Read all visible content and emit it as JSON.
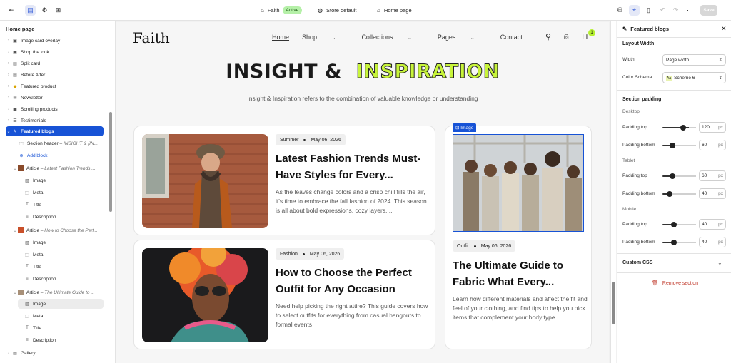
{
  "topbar": {
    "store_name": "Faith",
    "status_badge": "Active",
    "store_default": "Store default",
    "page_name": "Home page",
    "save_label": "Save"
  },
  "left_panel": {
    "title": "Home page",
    "items": [
      {
        "label": "Image card overlay",
        "icon": "image-icon"
      },
      {
        "label": "Shop the look",
        "icon": "image-icon"
      },
      {
        "label": "Split card",
        "icon": "grid-icon"
      },
      {
        "label": "Before After",
        "icon": "grid-icon"
      },
      {
        "label": "Featured product",
        "icon": "tag-icon"
      },
      {
        "label": "Newsletter",
        "icon": "mail-icon"
      },
      {
        "label": "Scrolling products",
        "icon": "image-icon"
      },
      {
        "label": "Testimonials",
        "icon": "list-icon"
      },
      {
        "label": "Featured blogs",
        "icon": "edit-icon"
      },
      {
        "label": "Section header",
        "suffix": "– INSIGHT & [IN..."
      },
      {
        "label": "Add block"
      },
      {
        "label": "Article",
        "suffix": "– Latest Fashion Trends ..."
      },
      {
        "label": "Image"
      },
      {
        "label": "Meta"
      },
      {
        "label": "Title"
      },
      {
        "label": "Description"
      },
      {
        "label": "Article",
        "suffix": "– How to Choose the Perf..."
      },
      {
        "label": "Image"
      },
      {
        "label": "Meta"
      },
      {
        "label": "Title"
      },
      {
        "label": "Description"
      },
      {
        "label": "Article",
        "suffix": "– The Ultimate Guide to ..."
      },
      {
        "label": "Image"
      },
      {
        "label": "Meta"
      },
      {
        "label": "Title"
      },
      {
        "label": "Description"
      },
      {
        "label": "Gallery"
      }
    ]
  },
  "site": {
    "logo": "Faith",
    "nav": [
      "Home",
      "Shop",
      "Collections",
      "Pages",
      "Contact"
    ],
    "cart_count": "1",
    "title_part1": "INSIGHT &",
    "title_part2": "INSPIRATION",
    "subtitle": "Insight & Inspiration refers to the combination of valuable knowledge or understanding",
    "image_tag": "Image",
    "articles": [
      {
        "category": "Summer",
        "date": "May 06, 2026",
        "title": "Latest Fashion Trends Must-Have Styles for Every...",
        "desc": "As the leaves change colors and a crisp chill fills the air, it's time to embrace the fall fashion of 2024. This season is all about bold expressions, cozy layers,..."
      },
      {
        "category": "Fashion",
        "date": "May 06, 2026",
        "title": "How to Choose the Perfect Outfit for Any Occasion",
        "desc": "Need help picking the right attire? This guide covers how to select outfits for everything from casual hangouts to formal events"
      },
      {
        "category": "Outfit",
        "date": "May 06, 2026",
        "title": "The Ultimate Guide to Fabric What Every...",
        "desc": "Learn how different materials and affect the fit and feel of your clothing, and find tips to help you pick items that complement your body type."
      }
    ]
  },
  "right_panel": {
    "title": "Featured blogs",
    "layout_width_heading": "Layout Width",
    "width_label": "Width",
    "width_value": "Page width",
    "color_schema_label": "Color Schema",
    "color_schema_value": "Scheme 6",
    "section_padding_heading": "Section padding",
    "desktop_label": "Desktop",
    "tablet_label": "Tablet",
    "mobile_label": "Mobile",
    "padding_top_label": "Padding top",
    "padding_bottom_label": "Padding bottom",
    "unit": "px",
    "desktop_top": "120",
    "desktop_bottom": "60",
    "tablet_top": "60",
    "tablet_bottom": "40",
    "mobile_top": "40",
    "mobile_bottom": "40",
    "custom_css_label": "Custom CSS",
    "remove_label": "Remove section"
  }
}
